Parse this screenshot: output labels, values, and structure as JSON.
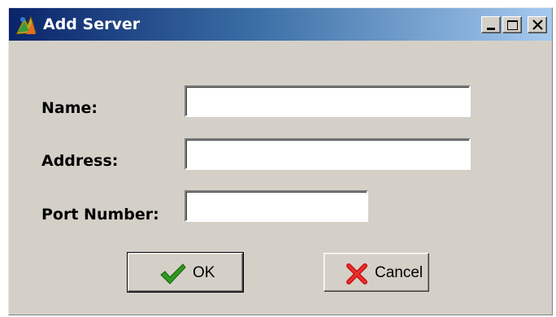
{
  "window": {
    "title": "Add Server",
    "icon": "app-server-icon",
    "controls": {
      "minimize_icon": "minimize-icon",
      "maximize_icon": "maximize-icon",
      "close_icon": "close-icon"
    }
  },
  "form": {
    "name": {
      "label": "Name:",
      "value": ""
    },
    "address": {
      "label": "Address:",
      "value": ""
    },
    "port": {
      "label": "Port Number:",
      "value": ""
    }
  },
  "buttons": {
    "ok": {
      "label": "OK",
      "icon": "checkmark-icon",
      "icon_color": "#2e9a1e"
    },
    "cancel": {
      "label": "Cancel",
      "icon": "red-x-icon",
      "icon_color": "#cc1111"
    }
  },
  "colors": {
    "title_gradient_start": "#0a246a",
    "title_gradient_end": "#a6caf0",
    "window_face": "#d4d0c8"
  }
}
